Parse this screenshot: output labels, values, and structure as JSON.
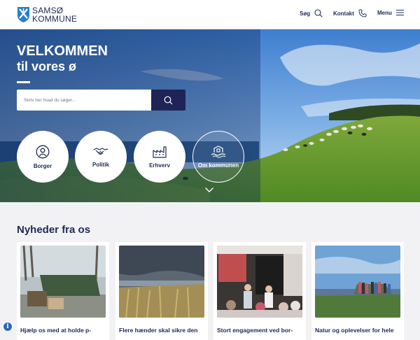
{
  "header": {
    "logo_line1": "SAMSØ",
    "logo_line2": "KOMMUNE",
    "nav": [
      {
        "label": "Søg",
        "icon": "search-icon"
      },
      {
        "label": "Kontakt",
        "icon": "phone-icon"
      },
      {
        "label": "Menu",
        "icon": "hamburger-icon"
      }
    ]
  },
  "hero": {
    "title_line1": "VELKOMMEN",
    "title_line2": "til vores ø",
    "search_placeholder": "Skriv her hvad du søger...",
    "shortcuts": [
      {
        "label": "Borger",
        "icon": "person-icon"
      },
      {
        "label": "Politik",
        "icon": "handshake-icon"
      },
      {
        "label": "Erhverv",
        "icon": "factory-icon"
      },
      {
        "label": "Om kommunen",
        "icon": "island-home-icon"
      }
    ]
  },
  "news": {
    "heading": "Nyheder fra os",
    "items": [
      {
        "title": "Hjælp os med at holde p-"
      },
      {
        "title": "Flere hænder skal sikre den"
      },
      {
        "title": "Stort engagement ved bor-"
      },
      {
        "title": "Natur og oplevelser for hele"
      }
    ]
  },
  "colors": {
    "brand": "#1e2a55",
    "search_button": "#1e2456",
    "info": "#2d67b5"
  }
}
